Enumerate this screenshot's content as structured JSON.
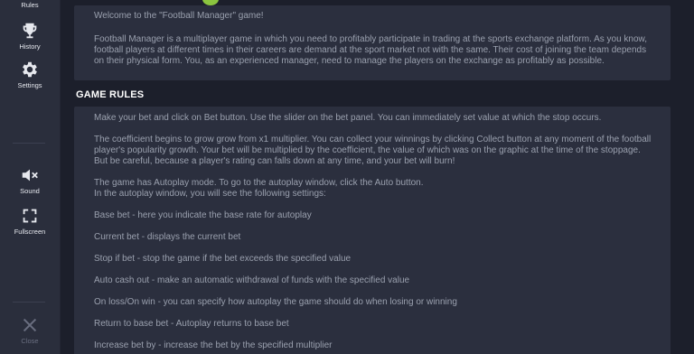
{
  "sidebar": {
    "rules_label": "Rules",
    "history_label": "History",
    "settings_label": "Settings",
    "sound_label": "Sound",
    "fullscreen_label": "Fullscreen",
    "close_label": "Close"
  },
  "intro": {
    "welcome": "Welcome to the \"Football Manager\" game!",
    "description": "Football Manager is a multiplayer game in which you need to profitably participate in trading at the sports exchange platform. As you know, football players at different times in their careers are demand at the sport market not with the same. Their cost of joining the team depends on their physical form. You, as an experienced manager, need to manage the players on the exchange as profitably as possible."
  },
  "rules": {
    "title": "GAME RULES",
    "paragraphs": [
      "Make your bet and click on Bet button. Use the slider on the bet panel. You can immediately set value at which the stop occurs.",
      "The coefficient begins to grow grow from x1 multiplier. You can collect your winnings by clicking Collect button at any moment of the football player's popularity growth. Your bet will be multiplied by the coefficient, the value of which was on the graphic at the time of the stoppage. But be careful, because a player's rating can falls down at any time, and your bet will burn!",
      "The game has Autoplay mode. To go to the autoplay window, click the Auto button.",
      "In the autoplay window, you will see the following settings:",
      "Base bet - here you indicate the base rate for autoplay",
      "Current bet - displays the current bet",
      "Stop if bet - stop the game if the bet exceeds the specified value",
      "Auto cash out - make an automatic withdrawal of funds with the specified value",
      "On loss/On win -  you can specify how autoplay the game should do when losing or winning",
      "Return to base bet - Autoplay returns to base bet",
      "Increase bet by - increase the bet by the specified multiplier"
    ]
  }
}
